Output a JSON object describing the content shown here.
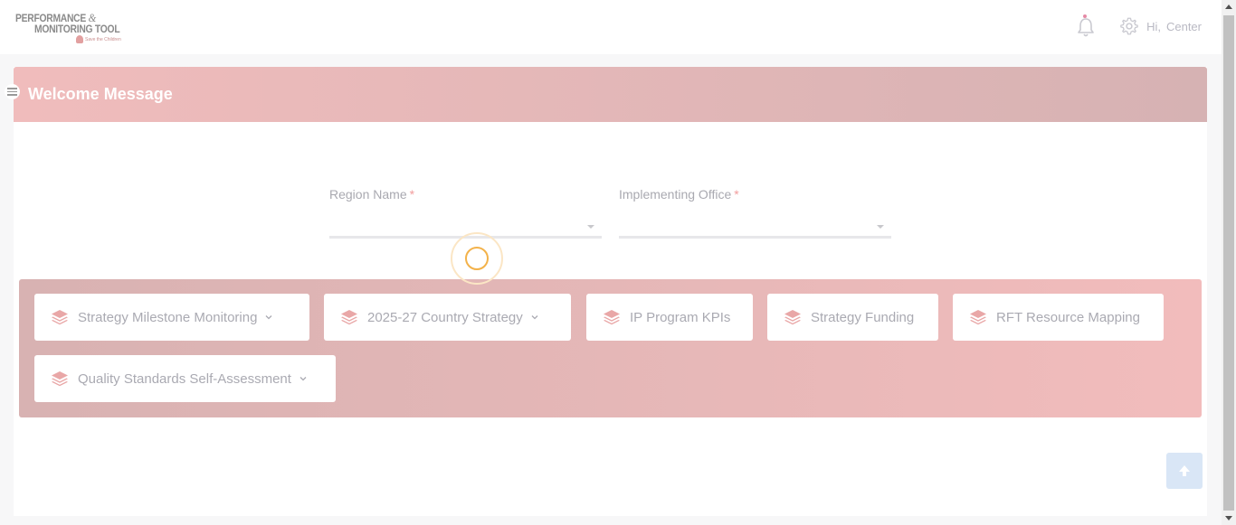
{
  "header": {
    "logo": {
      "line1": "PERFORMANCE",
      "amp": "&",
      "line2": "MONITORING TOOL",
      "org": "Save the Children"
    },
    "icons": {
      "notifications": "bell-icon",
      "settings": "gear-icon"
    },
    "greeting": "Hi,",
    "user_name": "Center"
  },
  "sidebar_toggle": {
    "icon": "hamburger-icon"
  },
  "welcome": {
    "title": "Welcome Message"
  },
  "filters": {
    "region": {
      "label": "Region Name",
      "required_mark": "*",
      "value": ""
    },
    "office": {
      "label": "Implementing Office",
      "required_mark": "*",
      "value": ""
    }
  },
  "modules": [
    {
      "label": "Strategy Milestone Monitoring",
      "icon": "layers-icon",
      "has_dropdown": true
    },
    {
      "label": "2025-27 Country Strategy",
      "icon": "layers-icon",
      "has_dropdown": true
    },
    {
      "label": "IP Program KPIs",
      "icon": "layers-icon",
      "has_dropdown": false
    },
    {
      "label": "Strategy Funding",
      "icon": "layers-icon",
      "has_dropdown": false
    },
    {
      "label": "RFT Resource Mapping",
      "icon": "layers-icon",
      "has_dropdown": false
    },
    {
      "label": "Quality Standards Self-Assessment",
      "icon": "layers-icon",
      "has_dropdown": true
    }
  ],
  "colors": {
    "welcome_start": "#f0bcbc",
    "welcome_end": "#d6b2b3",
    "panel_start": "#d8b2b2",
    "panel_end": "#f2bcbc",
    "spinner": "#f3b24a",
    "scroll_top_button": "#d9e6f6"
  }
}
